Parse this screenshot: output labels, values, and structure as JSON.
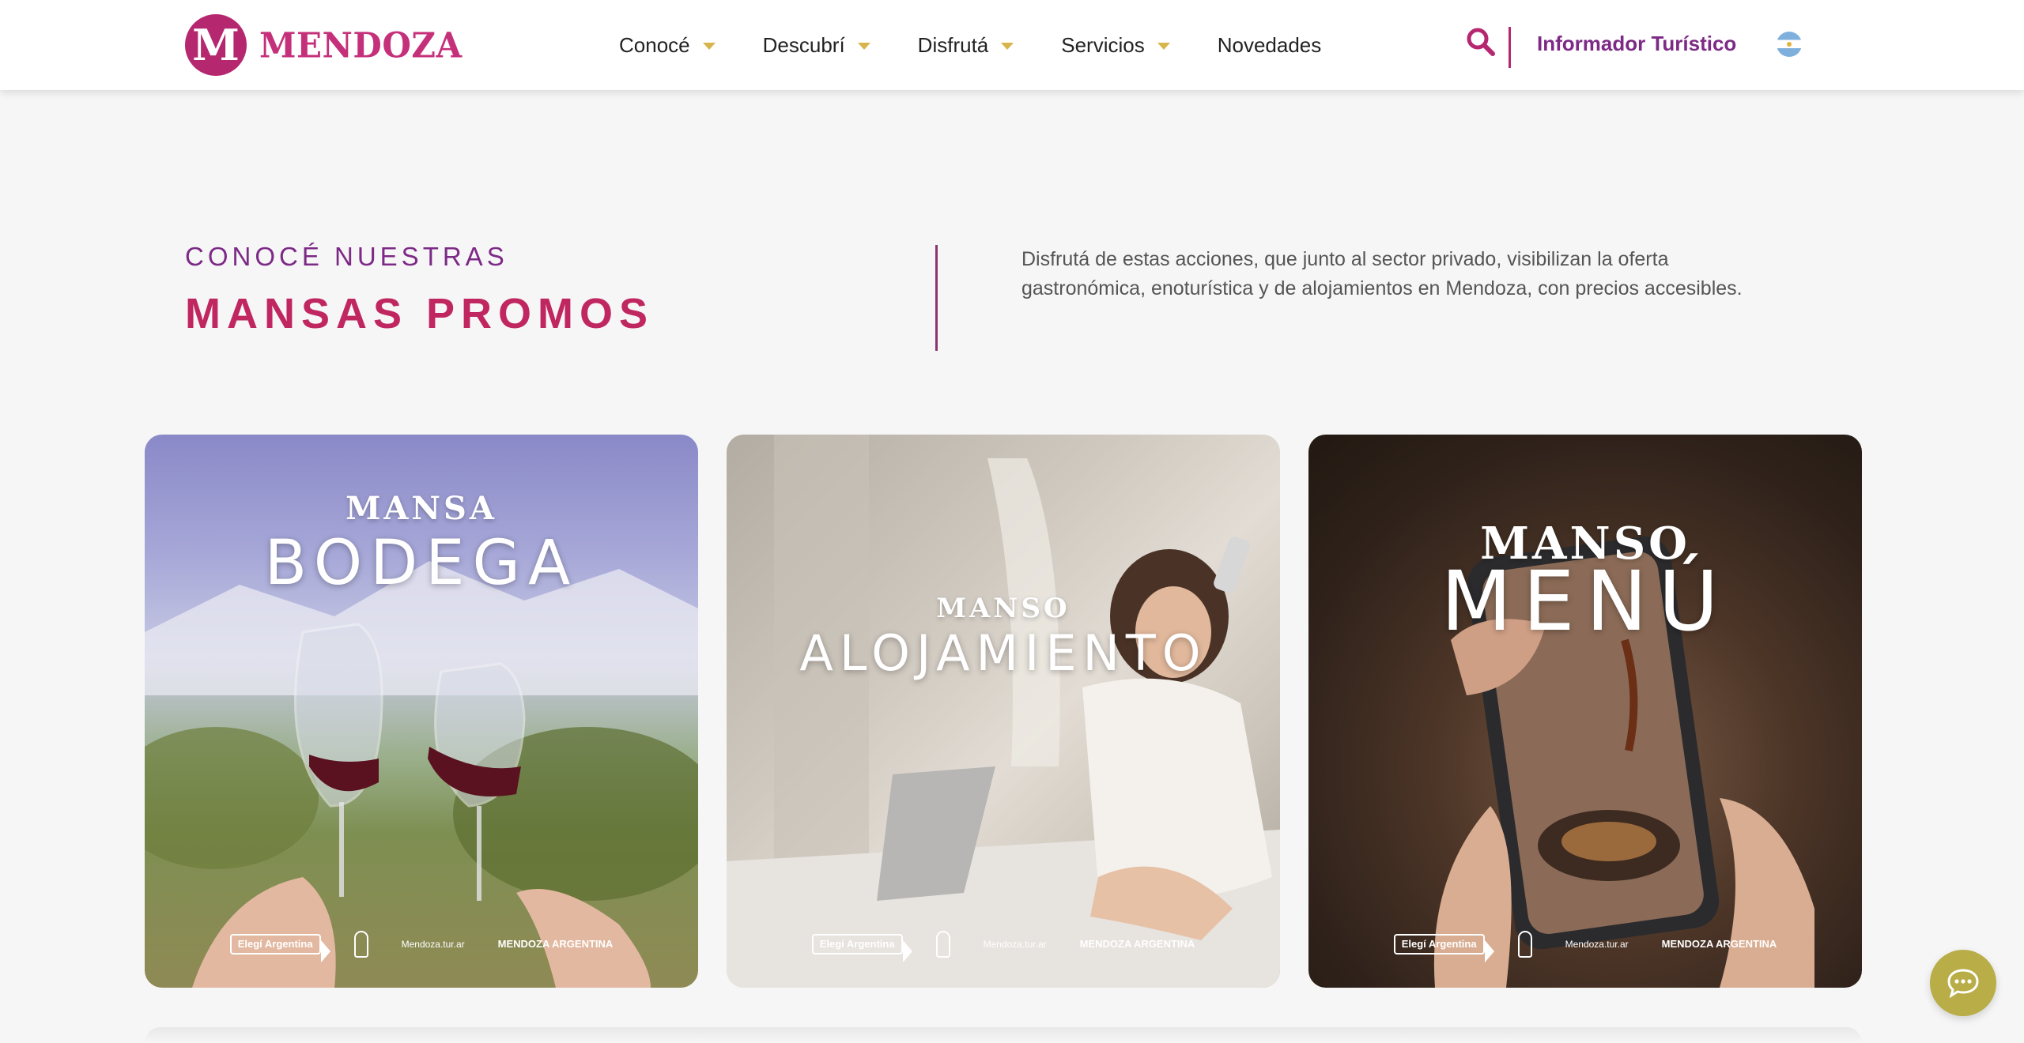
{
  "header": {
    "logo_mark": "M",
    "logo_text": "MENDOZA",
    "nav": [
      {
        "label": "Conocé",
        "has_dropdown": true
      },
      {
        "label": "Descubrí",
        "has_dropdown": true
      },
      {
        "label": "Disfrutá",
        "has_dropdown": true
      },
      {
        "label": "Servicios",
        "has_dropdown": true
      },
      {
        "label": "Novedades",
        "has_dropdown": false
      }
    ],
    "search_icon": "search-icon",
    "informador_label": "Informador Turístico",
    "language_flag": "argentina-flag"
  },
  "intro": {
    "kicker": "CONOCÉ NUESTRAS",
    "headline": "MANSAS PROMOS",
    "description": "Disfrutá de estas acciones, que junto al sector privado, visibilizan la oferta gastronómica, enoturística y de alojamientos en Mendoza, con precios accesibles."
  },
  "cards": [
    {
      "small": "MANSA",
      "big": "BODEGA"
    },
    {
      "small": "MANSO",
      "big": "ALOJAMIENTO"
    },
    {
      "small": "MANSO",
      "big": "MENÚ"
    }
  ],
  "card_footer": {
    "badge": "Elegí Argentina",
    "site": "Mendoza.tur.ar",
    "gov": "MENDOZA ARGENTINA"
  },
  "chat_icon": "chat-bubble-icon",
  "colors": {
    "brand_magenta": "#c0265f",
    "brand_purple": "#7d2a86",
    "nav_chevron": "#d7b54a",
    "chat_button": "#b9ad47",
    "background": "#f6f6f7"
  }
}
